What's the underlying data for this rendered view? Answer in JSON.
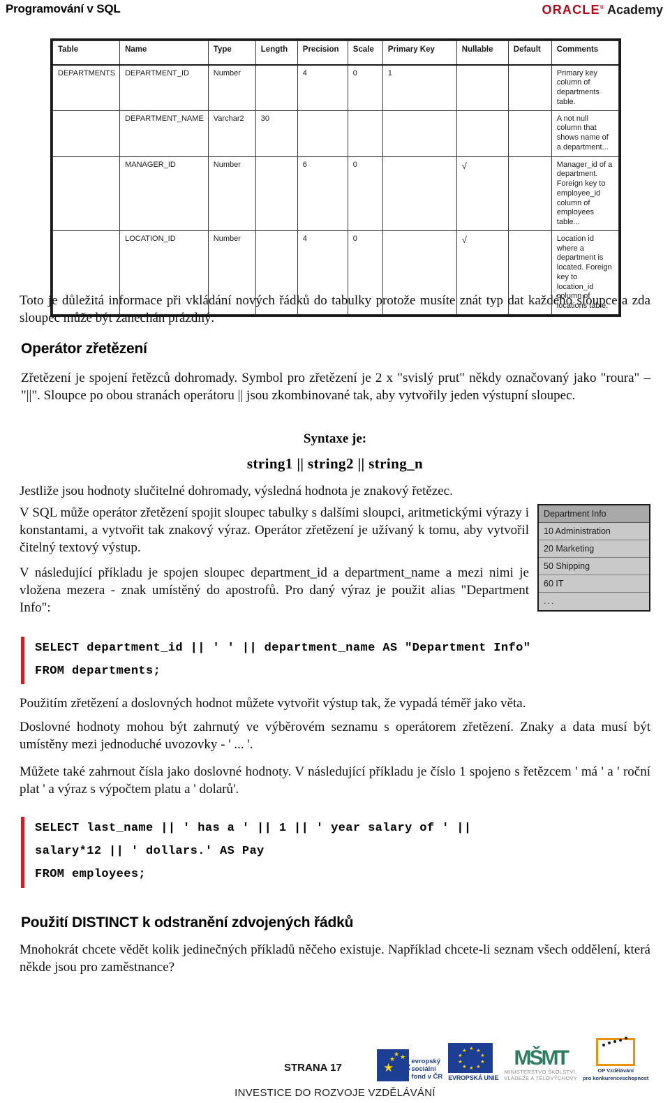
{
  "header": {
    "title": "Programování v SQL",
    "logo_oracle": "ORACLE",
    "logo_reg": "®",
    "logo_academy": "Academy",
    "accent_color": "#b4091b"
  },
  "table_figure": {
    "columns": [
      "Table",
      "Name",
      "Type",
      "Length",
      "Precision",
      "Scale",
      "Primary Key",
      "Nullable",
      "Default",
      "Comments"
    ],
    "rows": [
      {
        "table": "DEPARTMENTS",
        "name": "DEPARTMENT_ID",
        "type": "Number",
        "length": "",
        "precision": "4",
        "scale": "0",
        "primary_key": "1",
        "nullable": "",
        "default": "",
        "comments": "Primary key column of departments table."
      },
      {
        "table": "",
        "name": "DEPARTMENT_NAME",
        "type": "Varchar2",
        "length": "30",
        "precision": "",
        "scale": "",
        "primary_key": "",
        "nullable": "",
        "default": "",
        "comments": "A not null column that shows name of a department..."
      },
      {
        "table": "",
        "name": "MANAGER_ID",
        "type": "Number",
        "length": "",
        "precision": "6",
        "scale": "0",
        "primary_key": "",
        "nullable": "√",
        "default": "",
        "comments": "Manager_id of a department. Foreign key to employee_id column of employees table..."
      },
      {
        "table": "",
        "name": "LOCATION_ID",
        "type": "Number",
        "length": "",
        "precision": "4",
        "scale": "0",
        "primary_key": "",
        "nullable": "√",
        "default": "",
        "comments": "Location id where a department is located. Foreign key to location_id column of locations table."
      }
    ]
  },
  "content": {
    "intro_paragraph": "Toto je důležitá informace při vkládání nových řádků do  tabulky protože musíte znát typ dat každého sloupce a zda sloupec může být zanechán prázdný.",
    "heading_concat": "Operátor zřetězení",
    "para_concat_1": "Zřetězení je spojení řetězců dohromady. Symbol pro  zřetězení je 2 x \"svislý prut\" někdy  označovaný jako \"roura\" – \"||\". Sloupce po obou stranách  operátoru || jsou zkombinované tak, aby vytvořily jeden výstupní sloupec.",
    "syntax_label": "Syntaxe je:",
    "syntax_code": "string1 || string2 || string_n",
    "para_concat_2": "Jestliže jsou hodnoty slučitelné dohromady,  výsledná hodnota je znakový řetězec.",
    "para_concat_3": "V SQL může operátor zřetězení spojit sloupec tabulky s dalšími sloupci,  aritmetickými výrazy i konstantami, a vytvořit tak  znakový výraz. Operátor zřetězení je užívaný k tomu, aby vytvořil  čitelný textový výstup.",
    "para_concat_4": "V následující příkladu je spojen sloupec department_id a department_name a mezi nimi je vložena mezera - znak umístěný do apostrofů. Pro daný výraz je použit alias \"Department Info\":",
    "para_after_code_1": "Použitím zřetězení a doslovných hodnot můžete vytvořit výstup tak, že vypadá téměř jako věta.",
    "para_after_code_2": "Doslovné hodnoty mohou být zahrnutý ve výběrovém seznamu s operátorem zřetězení. Znaky a data musí být umístěny mezi jednoduché uvozovky  - ' ... '.",
    "para_after_code_3": "Můžete také zahrnout čísla jako doslovné hodnoty. V následující  příkladu je číslo 1 spojeno s řetězcem ' má ' a '  roční plat '  a výraz s výpočtem platu a ' dolarů'.",
    "heading_distinct": "Použití DISTINCT k odstranění zdvojených řádků",
    "para_distinct": "Mnohokrát chcete vědět kolik jedinečných příkladů něčeho existuje. Například chcete-li seznam všech  oddělení, která někde jsou pro zaměstnance?"
  },
  "code_block_1": {
    "accent_color": "#cf2027",
    "lines": [
      "SELECT department_id || ' ' || department_name AS \"Department Info\"",
      "FROM departments;"
    ]
  },
  "code_block_2": {
    "accent_color": "#cf2027",
    "lines": [
      "SELECT last_name || ' has a ' || 1 || ' year salary of ' ||",
      "salary*12 || ' dollars.' AS Pay",
      "FROM employees;"
    ]
  },
  "result_box": {
    "header": "Department Info",
    "rows": [
      "10 Administration",
      "20 Marketing",
      "50 Shipping",
      "60 IT",
      "..."
    ],
    "header_bg": "#a8a8a8",
    "row_bg": "#c9c9c9"
  },
  "footer": {
    "page_label": "STRANA 17",
    "esf_caption_1": "evropský",
    "esf_caption_2": "sociální",
    "esf_caption_3": "fond v ČR",
    "esf_letters": "esf",
    "eu_caption": "EVROPSKÁ UNIE",
    "msmt_mark": "MŠMT",
    "msmt_caption_1": "MINISTERSTVO ŠKOLSTVÍ,",
    "msmt_caption_2": "VLÁDEŽE A TĚLOVÝCHOVY",
    "opvk_caption_1": "OP Vzdělávání",
    "opvk_caption_2": "pro konkurenceschopnost",
    "investice": "INVESTICE DO ROZVOJE VZDĚLÁVÁNÍ"
  }
}
